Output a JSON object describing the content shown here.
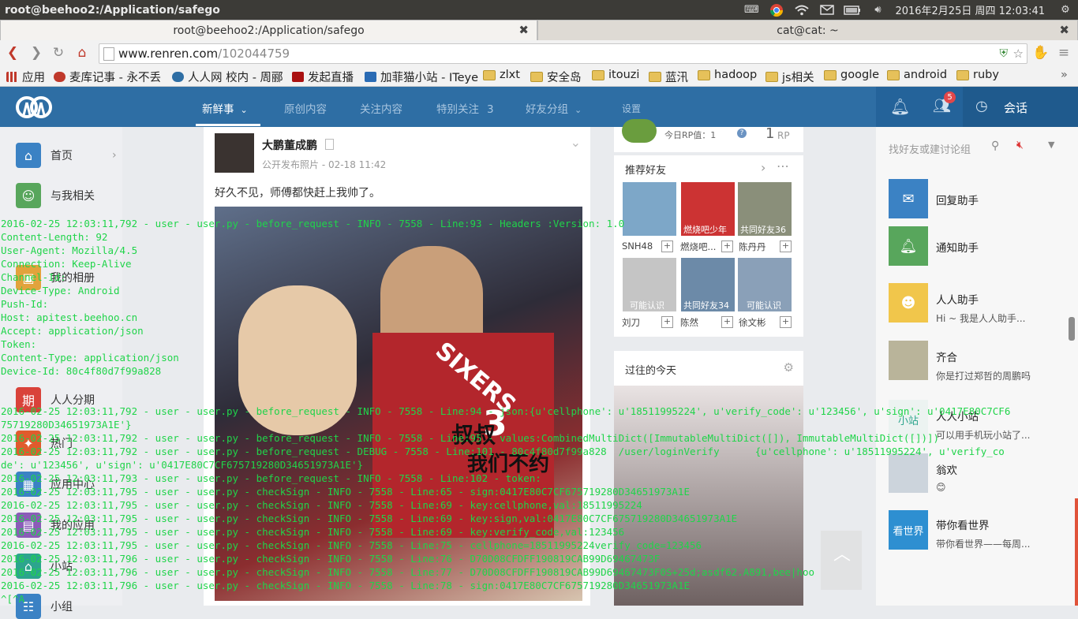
{
  "system_panel": {
    "window_title": "root@beehoo2:/Application/safego",
    "datetime": "2016年2月25日 周四 12:03:41",
    "tray_icons": [
      "keyboard-icon",
      "chrome-icon",
      "wifi-icon",
      "mail-icon",
      "battery-icon",
      "volume-icon"
    ]
  },
  "terminal_tabs": [
    {
      "label": "root@beehoo2:/Application/safego",
      "active": true
    },
    {
      "label": "cat@cat: ~",
      "active": false
    }
  ],
  "browser": {
    "url_host": "www.renren.com",
    "url_path": "/102044759",
    "bookmarks": [
      "应用",
      "麦库记事 - 永不丢",
      "人人网 校内 - 周郦",
      "发起直播",
      "加菲猫小站 - ITeye",
      "zlxt",
      "安全岛",
      "itouzi",
      "蓝汛",
      "hadoop",
      "js相关",
      "google",
      "android",
      "ruby"
    ]
  },
  "renren": {
    "nav": [
      {
        "label": "新鲜事",
        "suffix": "⌄",
        "active": true
      },
      {
        "label": "原创内容",
        "suffix": "",
        "active": false
      },
      {
        "label": "关注内容",
        "suffix": "",
        "active": false
      },
      {
        "label": "特别关注",
        "suffix": "3",
        "active": false
      },
      {
        "label": "好友分组",
        "suffix": "⌄",
        "active": false
      },
      {
        "label": "设置",
        "suffix": "",
        "active": false
      }
    ],
    "notification_count": "5",
    "talk_label": "会话",
    "sidebar": [
      "首页",
      "与我相关",
      "我的相册",
      "",
      "",
      "人人分期",
      "热门",
      "应用中心",
      "我的应用",
      "小站",
      "小组"
    ],
    "post": {
      "author": "大鹏董成鹏",
      "meta": "公开发布照片 - 02-18 11:42",
      "text": "好久不见，师傅都快赶上我帅了。",
      "photo_caption_1": "叔叔",
      "photo_caption_2": "我们不约",
      "jersey_text": "SIXERS",
      "jersey_number": "3"
    },
    "rp": {
      "today_label": "今日RP值：1",
      "value": "1",
      "unit": "RP"
    },
    "recommend": {
      "title": "推荐好友",
      "friends": [
        {
          "name": "SNH48",
          "caption": ""
        },
        {
          "name": "燃烧吧...",
          "caption": "燃烧吧少年"
        },
        {
          "name": "陈丹丹",
          "caption": "共同好友36"
        },
        {
          "name": "刘刀",
          "caption": "可能认识"
        },
        {
          "name": "陈然",
          "caption": "共同好友34"
        },
        {
          "name": "徐文彬",
          "caption": "可能认识"
        }
      ]
    },
    "past_today": {
      "title": "过往的今天"
    },
    "chat": {
      "search_placeholder": "找好友或建讨论组",
      "items": [
        {
          "name": "回复助手",
          "sub": ""
        },
        {
          "name": "通知助手",
          "sub": ""
        },
        {
          "name": "人人助手",
          "sub": "Hi ~ 我是人人助手..."
        },
        {
          "name": "齐合",
          "sub": "你是打过郑哲的周鹏吗"
        },
        {
          "name": "人人小站",
          "sub": "可以用手机玩小站了..."
        },
        {
          "name": "翁欢",
          "sub": "😊"
        },
        {
          "name": "带你看世界",
          "sub": "带你看世界——每周..."
        }
      ]
    }
  },
  "terminal_lines": [
    "2016-02-25 12:03:11,792 - user - user.py - before_request - INFO - 7558 - Line:93 - Headers :Version: 1.0",
    "Content-Length: 92",
    "User-Agent: Mozilla/4.5",
    "Connection: Keep-Alive",
    "Channel-Id:",
    "Device-Type: Android",
    "Push-Id:",
    "Host: apitest.beehoo.cn",
    "Accept: application/json",
    "Token:",
    "Content-Type: application/json",
    "Device-Id: 80c4f80d7f99a828",
    "",
    "",
    "2016-02-25 12:03:11,792 - user - user.py - before_request - INFO - 7558 - Line:94 - json:{u'cellphone': u'18511995224', u'verify_code': u'123456', u'sign': u'0417E80C7CF6",
    "75719280D34651973A1E'}",
    "2016-02-25 12:03:11,792 - user - user.py - before_request - INFO - 7558 - Line:95 - values:CombinedMultiDict([ImmutableMultiDict([]), ImmutableMultiDict([])])",
    "2016-02-25 12:03:11,792 - user - user.py - before_request - DEBUG - 7558 - Line:101 - 80c4f80d7f99a828  /user/loginVerify      {u'cellphone': u'18511995224', u'verify_co",
    "de': u'123456', u'sign': u'0417E80C7CF675719280D34651973A1E'}",
    "2016-02-25 12:03:11,793 - user - user.py - before_request - INFO - 7558 - Line:102 - token:",
    "2016-02-25 12:03:11,795 - user - user.py - checkSign - INFO - 7558 - Line:65 - sign:0417E80C7CF675719280D34651973A1E",
    "2016-02-25 12:03:11,795 - user - user.py - checkSign - INFO - 7558 - Line:69 - key:cellphone,val:18511995224",
    "2016-02-25 12:03:11,795 - user - user.py - checkSign - INFO - 7558 - Line:69 - key:sign,val:0417E80C7CF675719280D34651973A1E",
    "2016-02-25 12:03:11,795 - user - user.py - checkSign - INFO - 7558 - Line:69 - key:verify_code,val:123456",
    "2016-02-25 12:03:11,795 - user - user.py - checkSign - INFO - 7558 - Line:75 - cellphone=18511995224verify_code=123456",
    "2016-02-25 12:03:11,796 - user - user.py - checkSign - INFO - 7558 - Line:76 - D70D08CFDFF190819CAB99D69467473F",
    "2016-02-25 12:03:11,796 - user - user.py - checkSign - INFO - 7558 - Line:77 - D70D08CFDFF190819CAB99D69467473F0S+25d;asdf62.A891,bee|hoo",
    "2016-02-25 12:03:11,796 - user - user.py - checkSign - INFO - 7558 - Line:78 - sign:0417E80C7CF675719280D34651973A1E",
    "^[^A"
  ],
  "colors": {
    "terminal_text": "#20d44a",
    "renren_blue": "#2e6ea4",
    "panel": "#3c3b37"
  }
}
